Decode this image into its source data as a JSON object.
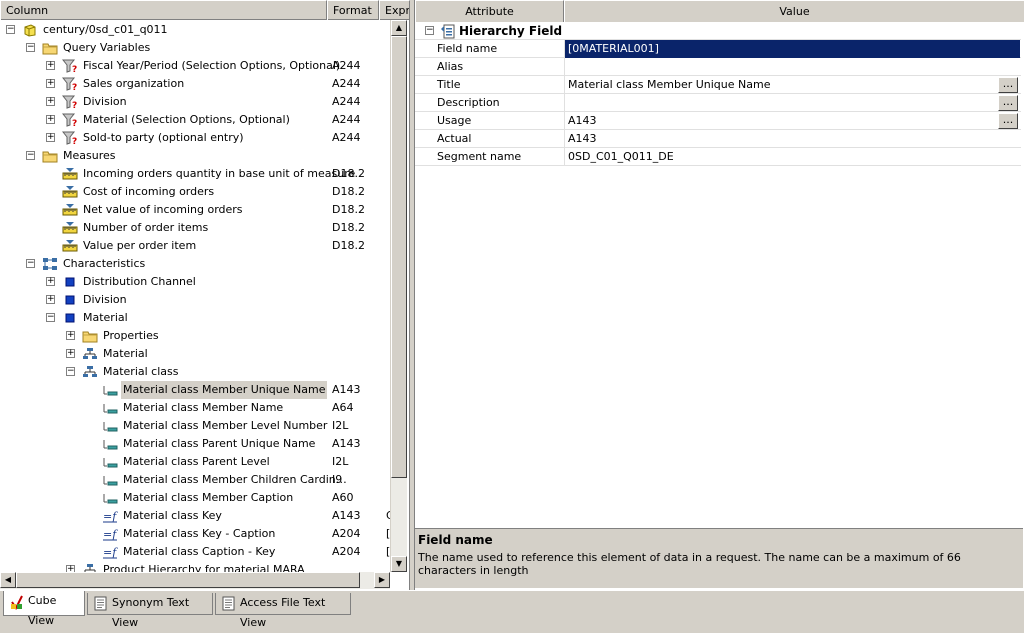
{
  "left_header": {
    "col1": "Column",
    "col2": "Format",
    "col3": "Expr"
  },
  "tree": [
    {
      "label": "century/0sd_c01_q011",
      "icon": "cube-icon",
      "level": 0,
      "expander": "minus",
      "format": "",
      "ex": ""
    },
    {
      "label": "Query Variables",
      "icon": "folder-icon",
      "level": 1,
      "expander": "minus",
      "format": "",
      "ex": ""
    },
    {
      "label": "Fiscal Year/Period (Selection Options, Optional)",
      "icon": "filter-icon",
      "level": 2,
      "expander": "plus",
      "format": "A244",
      "ex": ""
    },
    {
      "label": "Sales organization",
      "icon": "filter-icon",
      "level": 2,
      "expander": "plus",
      "format": "A244",
      "ex": ""
    },
    {
      "label": "Division",
      "icon": "filter-icon",
      "level": 2,
      "expander": "plus",
      "format": "A244",
      "ex": ""
    },
    {
      "label": "Material (Selection Options, Optional)",
      "icon": "filter-icon",
      "level": 2,
      "expander": "plus",
      "format": "A244",
      "ex": ""
    },
    {
      "label": "Sold-to party (optional entry)",
      "icon": "filter-icon",
      "level": 2,
      "expander": "plus",
      "format": "A244",
      "ex": ""
    },
    {
      "label": "Measures",
      "icon": "folder-icon",
      "level": 1,
      "expander": "minus",
      "format": "",
      "ex": ""
    },
    {
      "label": "Incoming orders quantity in base unit of measure",
      "icon": "ruler-icon",
      "level": 2,
      "expander": "",
      "format": "D18.2",
      "ex": ""
    },
    {
      "label": "Cost of incoming orders",
      "icon": "ruler-icon",
      "level": 2,
      "expander": "",
      "format": "D18.2",
      "ex": ""
    },
    {
      "label": "Net value of incoming orders",
      "icon": "ruler-icon",
      "level": 2,
      "expander": "",
      "format": "D18.2",
      "ex": ""
    },
    {
      "label": "Number of order items",
      "icon": "ruler-icon",
      "level": 2,
      "expander": "",
      "format": "D18.2",
      "ex": ""
    },
    {
      "label": "Value per order item",
      "icon": "ruler-icon",
      "level": 2,
      "expander": "",
      "format": "D18.2",
      "ex": ""
    },
    {
      "label": "Characteristics",
      "icon": "hierarchy-icon",
      "level": 1,
      "expander": "minus",
      "format": "",
      "ex": ""
    },
    {
      "label": "Distribution Channel",
      "icon": "dimension-icon",
      "level": 2,
      "expander": "plus",
      "format": "",
      "ex": ""
    },
    {
      "label": "Division",
      "icon": "dimension-icon",
      "level": 2,
      "expander": "plus",
      "format": "",
      "ex": ""
    },
    {
      "label": "Material",
      "icon": "dimension-icon",
      "level": 2,
      "expander": "minus",
      "format": "",
      "ex": ""
    },
    {
      "label": "Properties",
      "icon": "folder-icon",
      "level": 3,
      "expander": "plus",
      "format": "",
      "ex": ""
    },
    {
      "label": "Material",
      "icon": "hierarchy-tree-icon",
      "level": 3,
      "expander": "plus",
      "format": "",
      "ex": ""
    },
    {
      "label": "Material class",
      "icon": "hierarchy-tree-icon",
      "level": 3,
      "expander": "minus",
      "format": "",
      "ex": ""
    },
    {
      "label": "Material class Member Unique Name",
      "icon": "field-icon",
      "level": 4,
      "expander": "",
      "format": "A143",
      "ex": "",
      "selected": true
    },
    {
      "label": "Material class Member Name",
      "icon": "field-icon",
      "level": 4,
      "expander": "",
      "format": "A64",
      "ex": ""
    },
    {
      "label": "Material class Member Level Number",
      "icon": "field-icon",
      "level": 4,
      "expander": "",
      "format": "I2L",
      "ex": ""
    },
    {
      "label": "Material class Parent Unique Name",
      "icon": "field-icon",
      "level": 4,
      "expander": "",
      "format": "A143",
      "ex": ""
    },
    {
      "label": "Material class Parent Level",
      "icon": "field-icon",
      "level": 4,
      "expander": "",
      "format": "I2L",
      "ex": ""
    },
    {
      "label": "Material class Member Children Cardin…",
      "icon": "field-icon",
      "level": 4,
      "expander": "",
      "format": "I9",
      "ex": ""
    },
    {
      "label": "Material class Member Caption",
      "icon": "field-icon",
      "level": 4,
      "expander": "",
      "format": "A60",
      "ex": ""
    },
    {
      "label": "Material class  Key",
      "icon": "function-icon",
      "level": 4,
      "expander": "",
      "format": "A143",
      "ex": "G"
    },
    {
      "label": "Material class  Key - Caption",
      "icon": "function-icon",
      "level": 4,
      "expander": "",
      "format": "A204",
      "ex": "["
    },
    {
      "label": "Material class  Caption - Key",
      "icon": "function-icon",
      "level": 4,
      "expander": "",
      "format": "A204",
      "ex": "["
    },
    {
      "label": "Product Hierarchy for material MARA",
      "icon": "hierarchy-tree-icon",
      "level": 3,
      "expander": "plus",
      "format": "",
      "ex": ""
    }
  ],
  "props": {
    "header_attr": "Attribute",
    "header_value": "Value",
    "group_title": "Hierarchy Field",
    "rows": [
      {
        "attr": "Field name",
        "value": "[0MATERIAL001]",
        "selected": true,
        "button": false
      },
      {
        "attr": "Alias",
        "value": "",
        "selected": false,
        "button": false
      },
      {
        "attr": "Title",
        "value": "Material class Member Unique Name",
        "selected": false,
        "button": true
      },
      {
        "attr": "Description",
        "value": "",
        "selected": false,
        "button": true
      },
      {
        "attr": "Usage",
        "value": "A143",
        "selected": false,
        "button": true
      },
      {
        "attr": "Actual",
        "value": "A143",
        "selected": false,
        "button": false
      },
      {
        "attr": "Segment name",
        "value": "0SD_C01_Q011_DE",
        "selected": false,
        "button": false
      }
    ],
    "button_label": "..."
  },
  "description": {
    "title": "Field name",
    "text": "The name used to reference this element of data in a request. The name can be a maximum of 66 characters in length"
  },
  "tabs": [
    {
      "label": "Cube View",
      "icon": "cube-view-icon",
      "active": true
    },
    {
      "label": "Synonym Text View",
      "icon": "document-icon",
      "active": false
    },
    {
      "label": "Access File Text View",
      "icon": "document-icon",
      "active": false
    }
  ],
  "colors": {
    "selection": "#0a246a",
    "chrome": "#d4d0c8"
  }
}
